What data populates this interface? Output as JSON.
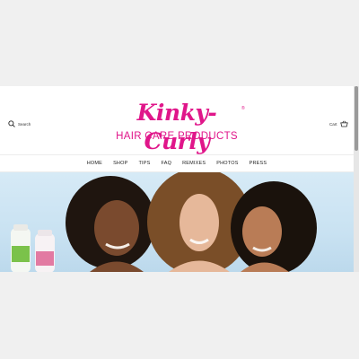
{
  "header": {
    "search_label": "Search",
    "logo_script": "Kinky-Curly",
    "logo_registered": "®",
    "logo_subtitle": "HAIR CARE PRODUCTS",
    "cart_label": "Cart"
  },
  "nav": {
    "items": [
      "HOME",
      "SHOP",
      "TIPS",
      "FAQ",
      "REMIXES",
      "PHOTOS",
      "PRESS"
    ]
  },
  "hero": {
    "image": "three-smiling-women-with-curly-hair-and-product-bottles"
  },
  "colors": {
    "brand_pink": "#e0168a",
    "hero_sky": "#cfe5f4"
  }
}
